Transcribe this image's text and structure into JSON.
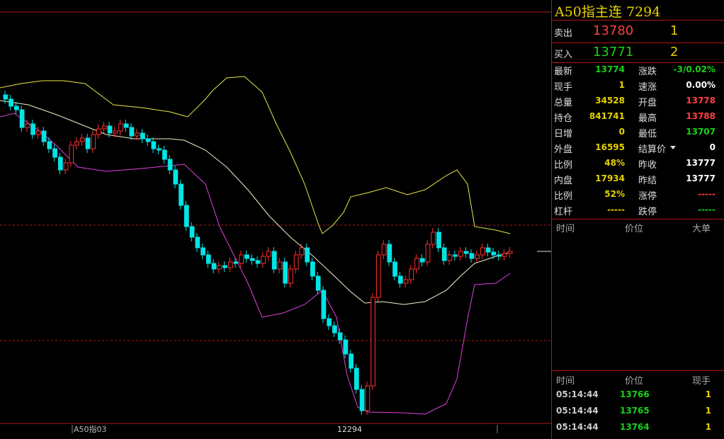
{
  "header": {
    "title": "A50指主连",
    "code": "7294"
  },
  "orderbook": {
    "sell": {
      "label": "卖出",
      "price": "13780",
      "qty": "1"
    },
    "buy": {
      "label": "买入",
      "price": "13771",
      "qty": "2"
    }
  },
  "quote": {
    "left": [
      {
        "label": "最新",
        "value": "13774",
        "color": "#19d219"
      },
      {
        "label": "现手",
        "value": "1",
        "color": "#e6d200"
      },
      {
        "label": "总量",
        "value": "34528",
        "color": "#e6d200"
      },
      {
        "label": "持仓",
        "value": "841741",
        "color": "#e6d200"
      },
      {
        "label": "日增",
        "value": "0",
        "color": "#e6d200"
      },
      {
        "label": "外盘",
        "value": "16595",
        "color": "#e6d200"
      },
      {
        "label": "比例",
        "value": "48%",
        "color": "#e6d200"
      },
      {
        "label": "内盘",
        "value": "17934",
        "color": "#e6d200"
      },
      {
        "label": "比例",
        "value": "52%",
        "color": "#e6d200"
      },
      {
        "label": "杠杆",
        "value": "-----",
        "color": "#e6d200"
      }
    ],
    "right": [
      {
        "label": "涨跌",
        "value": "-3/0.02%",
        "color": "#19d219"
      },
      {
        "label": "速涨",
        "value": "0.00%",
        "color": "#ffffff"
      },
      {
        "label": "开盘",
        "value": "13778",
        "color": "#ff4040"
      },
      {
        "label": "最高",
        "value": "13788",
        "color": "#ff4040"
      },
      {
        "label": "最低",
        "value": "13707",
        "color": "#19d219"
      },
      {
        "label": "结算价",
        "value": "0",
        "color": "#ffffff"
      },
      {
        "label": "昨收",
        "value": "13777",
        "color": "#ffffff"
      },
      {
        "label": "昨结",
        "value": "13777",
        "color": "#ffffff"
      },
      {
        "label": "涨停",
        "value": "-----",
        "color": "#ff4040"
      },
      {
        "label": "跌停",
        "value": "-----",
        "color": "#19d219"
      }
    ]
  },
  "big_orders": {
    "headers": [
      "时间",
      "价位",
      "大单"
    ]
  },
  "ticks": {
    "headers": [
      "时间",
      "价位",
      "现手"
    ],
    "rows": [
      {
        "time": "05:14:44",
        "price": "13766",
        "qty": "1"
      },
      {
        "time": "05:14:44",
        "price": "13765",
        "qty": "1"
      },
      {
        "time": "05:14:44",
        "price": "13764",
        "qty": "1"
      }
    ]
  },
  "chart_footer": {
    "symbol": "A50指03",
    "low_label": "12294"
  },
  "colors": {
    "up": "#ff3030",
    "down": "#00e5e5",
    "upper_band": "#e6e64a",
    "mid_band": "#f0f0c8",
    "lower_band": "#e040e0",
    "grid": "#b01818"
  },
  "chart_data": {
    "type": "candlestick",
    "note_units": "price levels read approximately from vertical position",
    "series": []
  }
}
